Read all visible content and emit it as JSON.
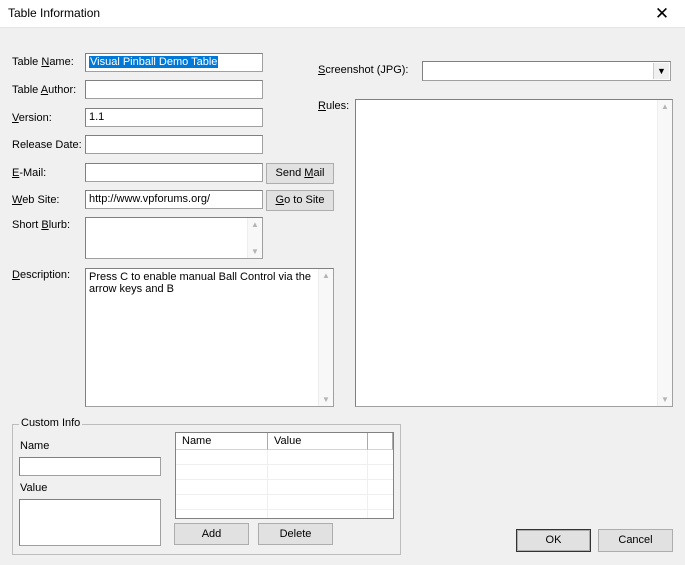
{
  "window": {
    "title": "Table Information",
    "close_glyph": "✕"
  },
  "labels": {
    "table_name_pre": "Table ",
    "table_name_u": "N",
    "table_name_post": "ame:",
    "author_pre": "Table ",
    "author_u": "A",
    "author_post": "uthor:",
    "version_u": "V",
    "version_post": "ersion:",
    "release_date": "Release Date:",
    "email_u": "E",
    "email_post": "-Mail:",
    "website_u": "W",
    "website_post": "eb Site:",
    "blurb_pre": "Short ",
    "blurb_u": "B",
    "blurb_post": "lurb:",
    "desc_u": "D",
    "desc_post": "escription:",
    "screenshot_u": "S",
    "screenshot_post": "creenshot (JPG):",
    "rules_u": "R",
    "rules_post": "ules:"
  },
  "fields": {
    "table_name": "Visual Pinball Demo Table",
    "table_author": "",
    "version": "1.1",
    "release_date": "",
    "email": "",
    "website": "http://www.vpforums.org/",
    "short_blurb": "",
    "description": "Press C to enable manual Ball Control via the arrow keys and B",
    "screenshot": "",
    "rules": ""
  },
  "buttons": {
    "send_mail_pre": "Send ",
    "send_mail_u": "M",
    "send_mail_post": "ail",
    "goto_pre": "",
    "goto_u": "G",
    "goto_post": "o to Site",
    "add": "Add",
    "delete": "Delete",
    "ok": "OK",
    "cancel": "Cancel"
  },
  "custom_info": {
    "group_title": "Custom Info",
    "name_label": "Name",
    "value_label": "Value",
    "name_value": "",
    "value_value": "",
    "columns": [
      "Name",
      "Value"
    ]
  },
  "icons": {
    "scroll_up": "▲",
    "scroll_down": "▼",
    "combo_arrow": "▼"
  }
}
